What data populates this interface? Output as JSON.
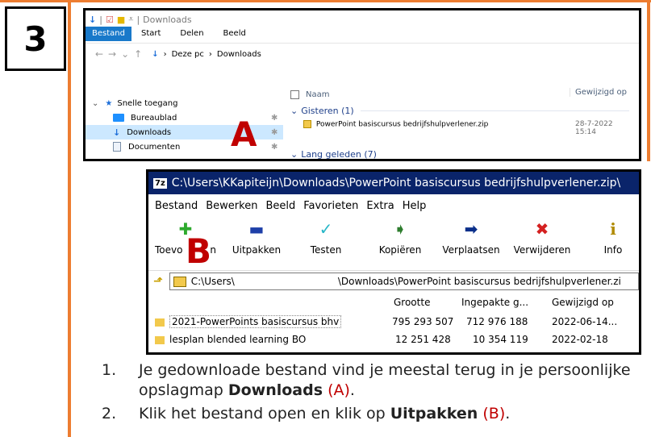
{
  "step_number": "3",
  "explorer": {
    "title_path": "Downloads",
    "ribbon_tabs": [
      "Bestand",
      "Start",
      "Delen",
      "Beeld"
    ],
    "breadcrumb": [
      "Deze pc",
      "Downloads"
    ],
    "nav": [
      {
        "label": "Snelle toegang"
      },
      {
        "label": "Bureaublad"
      },
      {
        "label": "Downloads"
      },
      {
        "label": "Documenten"
      }
    ],
    "columns": {
      "name": "Naam",
      "modified": "Gewijzigd op"
    },
    "groups": [
      {
        "label": "Gisteren (1)"
      },
      {
        "label": "Lang geleden (7)"
      }
    ],
    "file": {
      "name": "PowerPoint basiscursus bedrijfshulpverlener.zip",
      "modified": "28-7-2022 15:14"
    },
    "marker": "A"
  },
  "sevenzip": {
    "logo": "7z",
    "title": "C:\\Users\\KKapiteijn\\Downloads\\PowerPoint basiscursus bedrijfshulpverlener.zip\\",
    "menu": [
      "Bestand",
      "Bewerken",
      "Beeld",
      "Favorieten",
      "Extra",
      "Help"
    ],
    "toolbar": [
      {
        "label": "Toevoegen",
        "icon": "plus-icon"
      },
      {
        "label": "Uitpakken",
        "icon": "minus-icon"
      },
      {
        "label": "Testen",
        "icon": "check-icon"
      },
      {
        "label": "Kopiëren",
        "icon": "double-arrow-icon"
      },
      {
        "label": "Verplaatsen",
        "icon": "arrow-right-icon"
      },
      {
        "label": "Verwijderen",
        "icon": "x-icon"
      },
      {
        "label": "Info",
        "icon": "info-icon"
      }
    ],
    "toolbar_visible_labels": [
      "Toevo",
      "n",
      "Uitpakken",
      "Testen",
      "Kopiëren",
      "Verplaatsen",
      "Verwijderen",
      "Info"
    ],
    "path_left": "C:\\Users\\",
    "path_right": "\\Downloads\\PowerPoint basiscursus bedrijfshulpverlener.zi",
    "columns": [
      "Grootte",
      "Ingepakte g...",
      "Gewijzigd op"
    ],
    "rows": [
      {
        "name": "2021-PowerPoints basiscursus bhv",
        "size": "795 293 507",
        "packed": "712 976 188",
        "modified": "2022-06-14..."
      },
      {
        "name": "lesplan blended learning BO",
        "size": "12 251 428",
        "packed": "10 354 119",
        "modified": "2022-02-18"
      }
    ],
    "marker": "B"
  },
  "instructions": [
    {
      "num": "1.",
      "pre": "Je gedownloade bestand vind je meestal terug in je persoonlijke opslagmap ",
      "bold": "Downloads",
      "suffix": " (A)",
      "end": "."
    },
    {
      "num": "2.",
      "pre": "Klik het bestand open en klik op ",
      "bold": "Uitpakken",
      "suffix": " (B)",
      "end": "."
    }
  ],
  "colors": {
    "accent_orange": "#ed7d31",
    "marker_red": "#c00000",
    "explorer_blue": "#1979ca",
    "zip_title": "#0a246a"
  }
}
